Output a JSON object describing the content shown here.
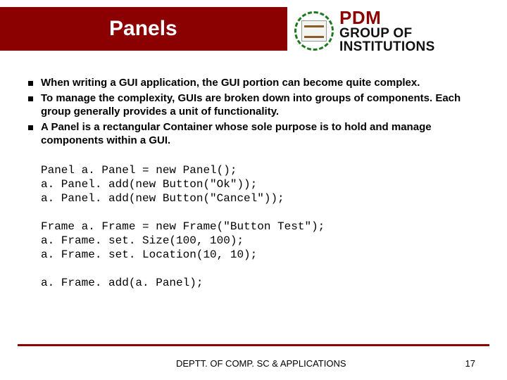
{
  "header": {
    "title": "Panels",
    "logo": {
      "top": "PDM",
      "line1": "GROUP OF",
      "line2": "INSTITUTIONS"
    }
  },
  "bullets": [
    "When writing a GUI application, the GUI portion can become quite complex.",
    " To manage the complexity, GUIs are broken down into groups of components. Each group generally provides a unit of functionality.",
    "A Panel is a rectangular Container whose sole purpose is to hold and manage components within a GUI."
  ],
  "code": {
    "block1": [
      "Panel a. Panel = new Panel();",
      "a. Panel. add(new Button(\"Ok\"));",
      "a. Panel. add(new Button(\"Cancel\"));"
    ],
    "block2": [
      "Frame a. Frame = new Frame(\"Button Test\");",
      "a. Frame. set. Size(100, 100);",
      "a. Frame. set. Location(10, 10);"
    ],
    "block3": [
      "a. Frame. add(a. Panel);"
    ]
  },
  "footer": {
    "dept": "DEPTT. OF COMP. SC & APPLICATIONS",
    "page": "17"
  }
}
